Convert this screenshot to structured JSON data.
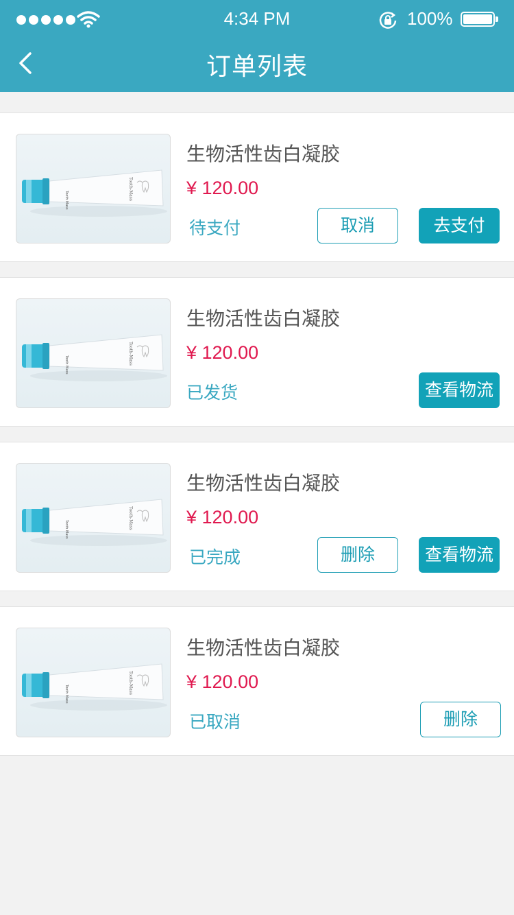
{
  "status_bar": {
    "time": "4:34 PM",
    "battery": "100%"
  },
  "header": {
    "title": "订单列表"
  },
  "orders": [
    {
      "product": "生物活性齿白凝胶",
      "price": "¥ 120.00",
      "status": "待支付",
      "actions": [
        "取消",
        "去支付"
      ]
    },
    {
      "product": "生物活性齿白凝胶",
      "price": "¥ 120.00",
      "status": "已发货",
      "actions": [
        "查看物流"
      ]
    },
    {
      "product": "生物活性齿白凝胶",
      "price": "¥ 120.00",
      "status": "已完成",
      "actions": [
        "删除",
        "查看物流"
      ]
    },
    {
      "product": "生物活性齿白凝胶",
      "price": "¥ 120.00",
      "status": "已取消",
      "actions": [
        "删除"
      ]
    }
  ],
  "colors": {
    "header_bg": "#3aa8c1",
    "price": "#e0194f",
    "status": "#3aa8c1",
    "button_primary": "#12a2b8"
  },
  "icons": {
    "back": "chevron-left-icon",
    "wifi": "wifi-icon",
    "rotation_lock": "rotation-lock-icon",
    "battery": "battery-icon",
    "signal": "signal-dots-icon"
  }
}
